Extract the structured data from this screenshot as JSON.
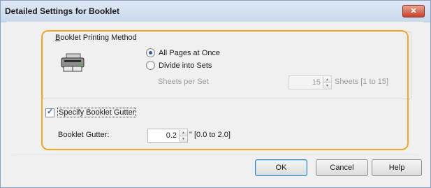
{
  "dialog": {
    "title": "Detailed Settings for Booklet",
    "close_glyph": "✕"
  },
  "booklet_method": {
    "legend": "Booklet Printing Method",
    "legend_access_key": "B",
    "legend_rest": "ooklet Printing Method",
    "options": [
      {
        "label": "All Pages at Once",
        "checked": true
      },
      {
        "label": "Divide into Sets",
        "checked": false
      }
    ],
    "sheets_per_set_label": "Sheets per Set",
    "sheets_per_set_value": "15",
    "sheets_per_set_range": "Sheets [1 to 15]"
  },
  "gutter": {
    "checkbox_label": "Specify Booklet Gutter",
    "checked": true,
    "label": "Booklet Gutter:",
    "value": "0.2",
    "range": "\" [0.0 to 2.0]"
  },
  "buttons": {
    "ok": "OK",
    "cancel": "Cancel",
    "help": "Help"
  },
  "colors": {
    "highlight": "#f5a623",
    "close_button": "#c8422a",
    "title_bar": "#c9d9ec"
  },
  "icons": {
    "booklet": "booklet-printer-icon",
    "spin": "up-down-arrow-icon"
  }
}
